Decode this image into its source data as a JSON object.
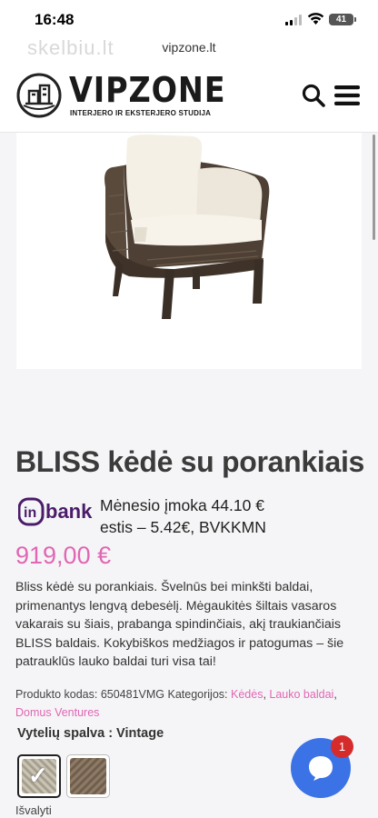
{
  "status": {
    "time": "16:48",
    "battery": "41"
  },
  "browser": {
    "url": "vipzone.lt",
    "watermark": "skelbiu.lt"
  },
  "header": {
    "brand": "VIPZONE",
    "tagline": "INTERJERO IR EKSTERJERO STUDIJA",
    "search_icon": "search-icon",
    "menu_icon": "hamburger-menu-icon"
  },
  "product": {
    "title": "BLISS kėdė su porankiais",
    "financing_logo": "inbank",
    "installment_line1": "Mėnesio įmoka 44.10 €",
    "installment_line2": "estis – 5.42€, BVKKMN",
    "price": "919,00 €",
    "description": "Bliss kėdė su porankiais. Švelnūs bei minkšti baldai, primenantys lengvą debesėlį. Mėgaukitės šiltais vasaros vakarais su šiais, prabanga spindinčiais, akį traukiančiais BLISS baldais. Kokybiškos medžiagos ir patogumas – šie patrauklūs lauko baldai turi visa tai!",
    "sku_label": "Produkto kodas:",
    "sku": "650481VMG",
    "categories_label": "Kategorijos:",
    "categories": [
      "Kėdės",
      "Lauko baldai",
      "Domus Ventures"
    ],
    "variant_label": "Vytelių spalva : Vintage",
    "clear_label": "Išvalyti"
  },
  "chat": {
    "badge": "1"
  },
  "colors": {
    "accent": "#e067b3",
    "chat": "#3b72e6",
    "badge": "#d62b2b"
  }
}
